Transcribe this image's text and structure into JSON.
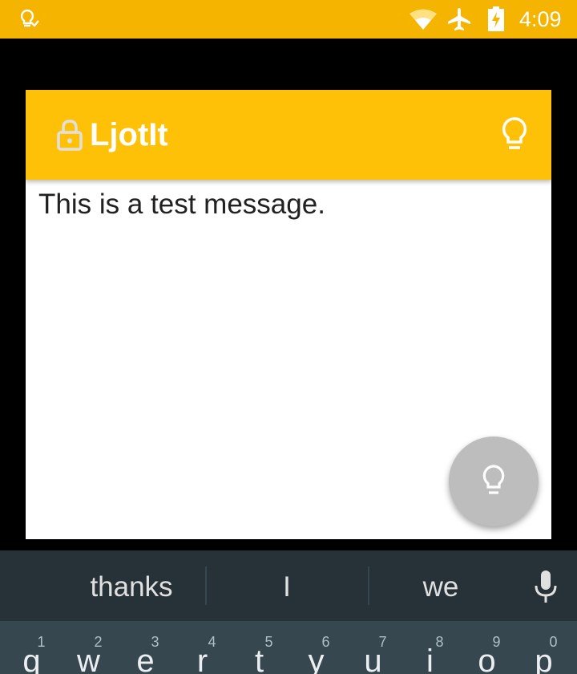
{
  "status_bar": {
    "time": "4:09",
    "icons": [
      "lightbulb-notification-icon",
      "wifi-icon",
      "airplane-mode-icon",
      "battery-charging-icon"
    ]
  },
  "app": {
    "title": "LjotIt",
    "header_color": "#FFC107",
    "status_color": "#F4B400",
    "header_icons": [
      "lock-icon",
      "lightbulb-icon"
    ],
    "message": "This is a test message.",
    "fab_icon": "lightbulb-icon"
  },
  "keyboard": {
    "suggestions": [
      "thanks",
      "I",
      "we"
    ],
    "voice_icon": "microphone-icon",
    "top_row": [
      {
        "hint": "1",
        "letter": "q"
      },
      {
        "hint": "2",
        "letter": "w"
      },
      {
        "hint": "3",
        "letter": "e"
      },
      {
        "hint": "4",
        "letter": "r"
      },
      {
        "hint": "5",
        "letter": "t"
      },
      {
        "hint": "6",
        "letter": "y"
      },
      {
        "hint": "7",
        "letter": "u"
      },
      {
        "hint": "8",
        "letter": "i"
      },
      {
        "hint": "9",
        "letter": "o"
      },
      {
        "hint": "0",
        "letter": "p"
      }
    ]
  }
}
